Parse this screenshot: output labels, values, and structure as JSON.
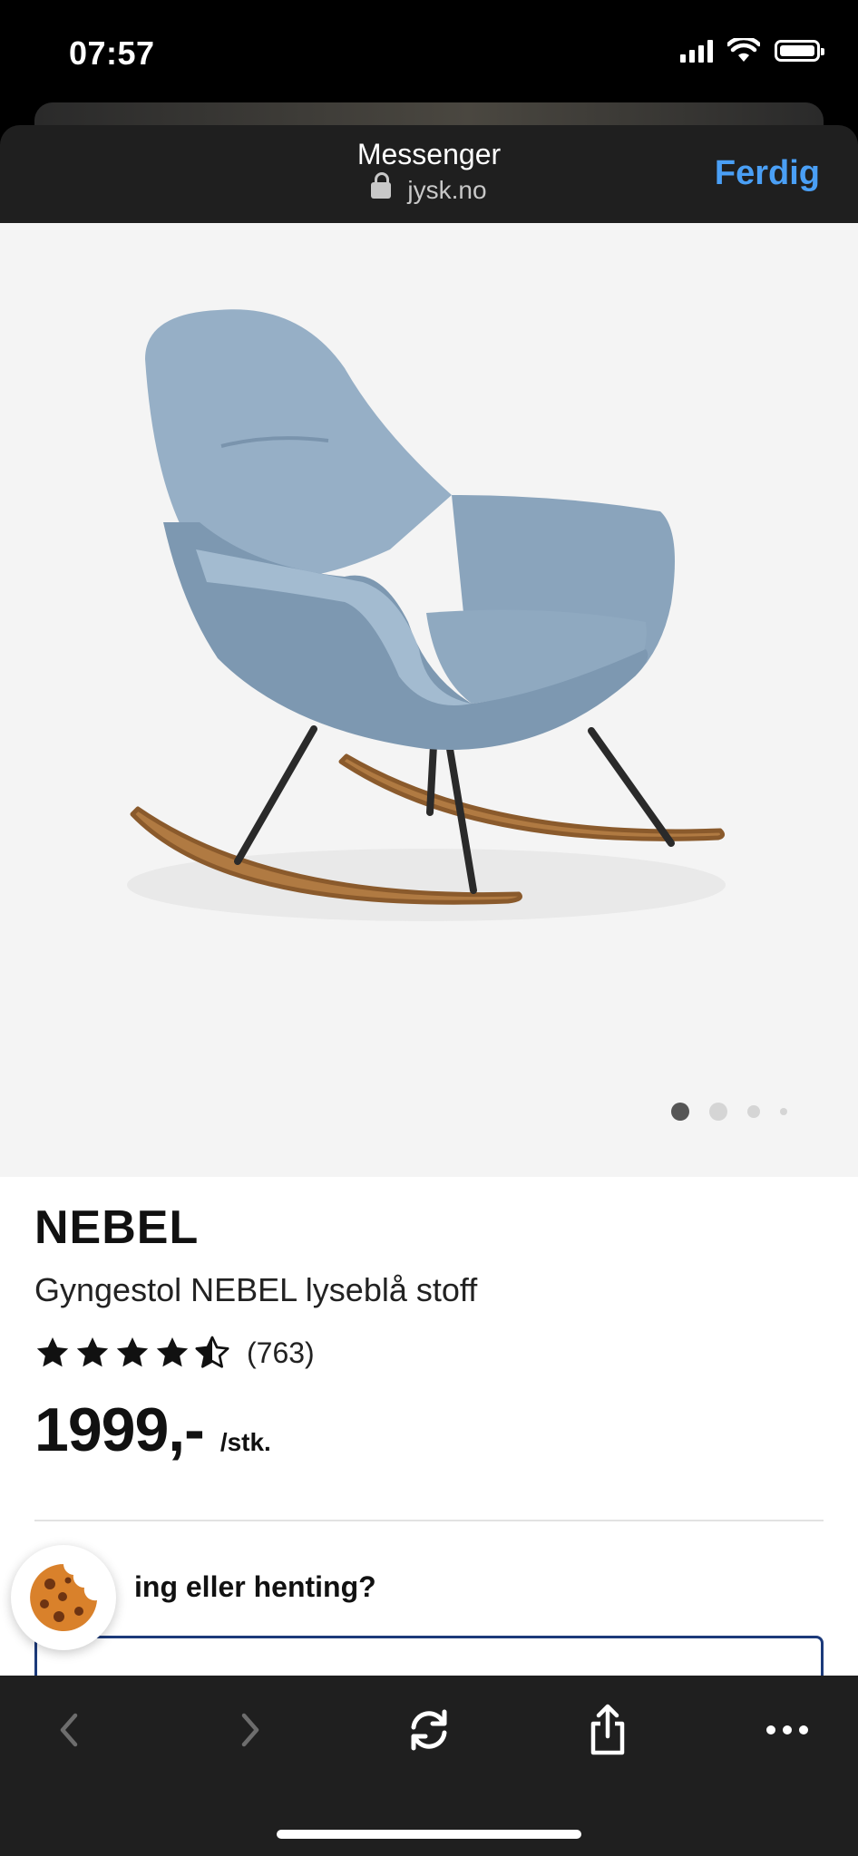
{
  "status_bar": {
    "time": "07:57"
  },
  "browser": {
    "title": "Messenger",
    "url": "jysk.no",
    "done_label": "Ferdig"
  },
  "product": {
    "brand": "NEBEL",
    "name": "Gyngestol NEBEL lyseblå stoff",
    "rating": 4.5,
    "rating_max": 5,
    "review_count": "(763)",
    "price": "1999,-",
    "price_unit": "/stk.",
    "image_count": 4,
    "active_image": 1
  },
  "delivery": {
    "question_visible": "ing eller henting?"
  },
  "icons": {
    "back": "chevron-left-icon",
    "forward": "chevron-right-icon",
    "reload": "reload-icon",
    "share": "share-icon",
    "more": "more-icon",
    "cookie": "cookie-icon"
  },
  "colors": {
    "accent": "#4a9ff5",
    "select_border": "#1c3a7a",
    "toolbar_bg": "#1f1f1f"
  }
}
